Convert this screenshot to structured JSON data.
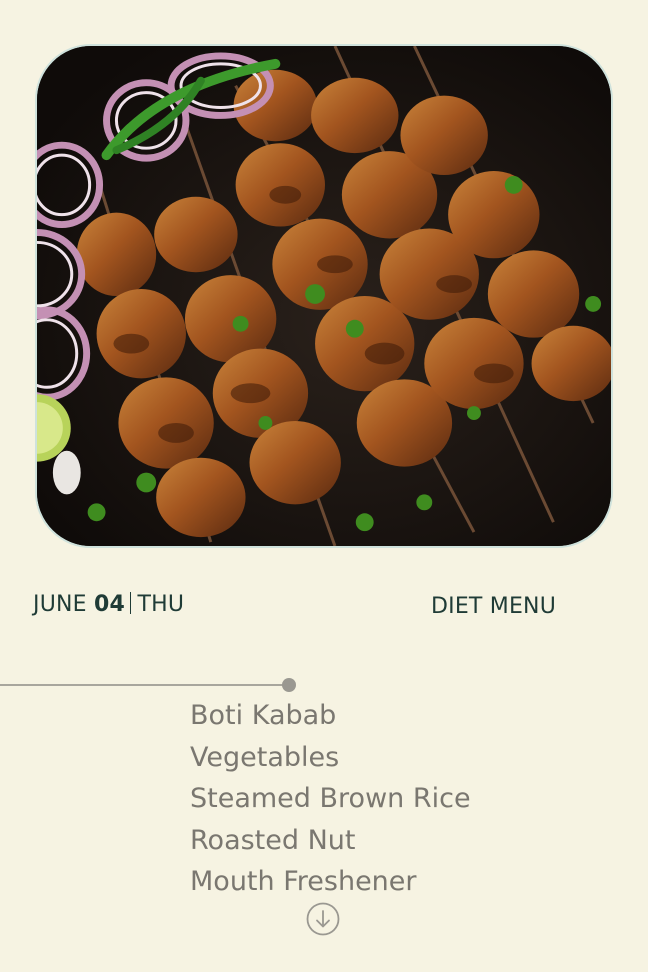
{
  "hero_image": {
    "alt": "Boti kabab skewers with onion rings, green chillies and lime"
  },
  "date": {
    "month": "JUNE",
    "day": "04",
    "weekday": "THU"
  },
  "menu_heading": "DIET MENU",
  "menu_items": [
    "Boti Kabab",
    "Vegetables",
    "Steamed Brown Rice",
    "Roasted Nut",
    "Mouth Freshener"
  ],
  "icons": {
    "scroll": "arrow-down-circle-icon"
  },
  "colors": {
    "background": "#f6f3e2",
    "heading_text": "#1f3b36",
    "menu_text": "#7a7770",
    "timeline": "#a8a69d"
  }
}
